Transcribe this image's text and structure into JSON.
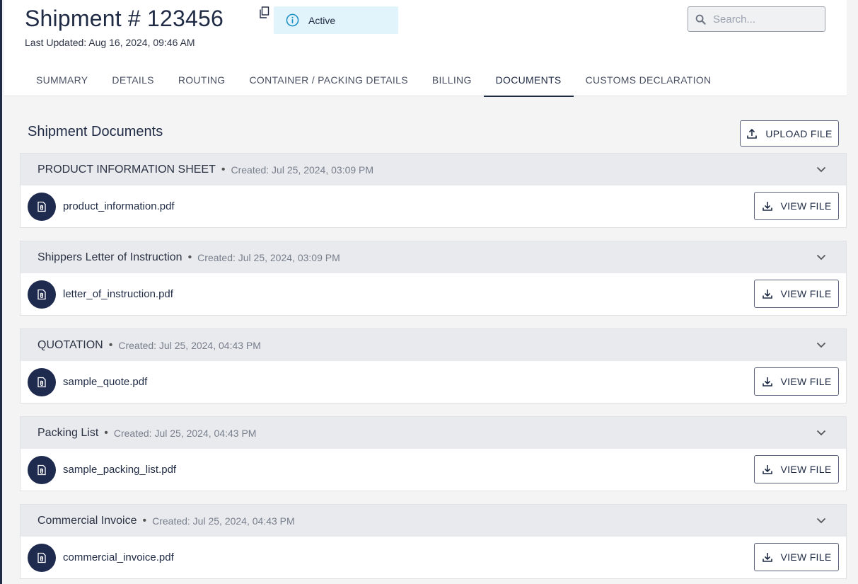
{
  "header": {
    "title": "Shipment # 123456",
    "last_updated": "Last Updated: Aug 16, 2024, 09:46 AM",
    "status": "Active",
    "search_placeholder": "Search..."
  },
  "tabs": [
    {
      "label": "SUMMARY",
      "active": false
    },
    {
      "label": "DETAILS",
      "active": false
    },
    {
      "label": "ROUTING",
      "active": false
    },
    {
      "label": "CONTAINER / PACKING DETAILS",
      "active": false
    },
    {
      "label": "BILLING",
      "active": false
    },
    {
      "label": "DOCUMENTS",
      "active": true
    },
    {
      "label": "CUSTOMS DECLARATION",
      "active": false
    }
  ],
  "section": {
    "title": "Shipment Documents",
    "upload_label": "UPLOAD FILE"
  },
  "documents": [
    {
      "type": "PRODUCT INFORMATION SHEET",
      "created": "Created: Jul 25, 2024, 03:09 PM",
      "file": "product_information.pdf",
      "button": "VIEW FILE"
    },
    {
      "type": "Shippers Letter of Instruction",
      "created": "Created: Jul 25, 2024, 03:09 PM",
      "file": "letter_of_instruction.pdf",
      "button": "VIEW FILE"
    },
    {
      "type": "QUOTATION",
      "created": "Created: Jul 25, 2024, 04:43 PM",
      "file": "sample_quote.pdf",
      "button": "VIEW FILE"
    },
    {
      "type": "Packing List",
      "created": "Created: Jul 25, 2024, 04:43 PM",
      "file": "sample_packing_list.pdf",
      "button": "VIEW FILE"
    },
    {
      "type": "Commercial Invoice",
      "created": "Created: Jul 25, 2024, 04:43 PM",
      "file": "commercial_invoice.pdf",
      "button": "VIEW FILE"
    }
  ],
  "colors": {
    "primary": "#1f2a44",
    "status_bg": "#e1f3fb",
    "status_icon": "#1a8fc4",
    "card_header_bg": "#e9eaed",
    "page_bg": "#f4f4f5"
  },
  "icons": {
    "copy": "copy-icon",
    "status": "info-icon",
    "search": "search-icon",
    "upload": "upload-icon",
    "file": "paperclip-file-icon",
    "download": "download-icon",
    "expand": "chevron-down-icon"
  }
}
